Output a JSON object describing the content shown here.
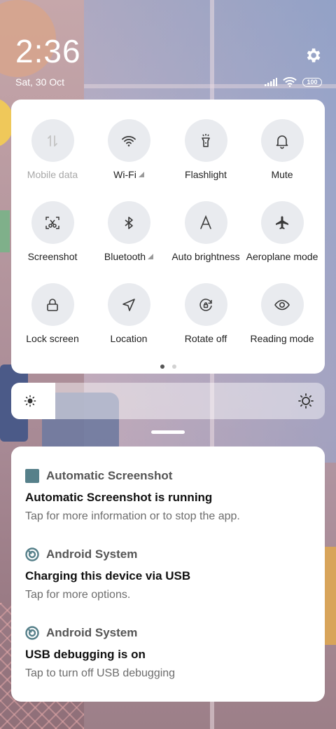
{
  "status": {
    "time": "2:36",
    "date": "Sat, 30 Oct",
    "battery": "100"
  },
  "quick_settings": {
    "tiles": [
      {
        "label": "Mobile data",
        "icon": "mobile-data-icon",
        "enabled": false
      },
      {
        "label": "Wi-Fi",
        "icon": "wifi-icon",
        "enabled": true
      },
      {
        "label": "Flashlight",
        "icon": "flashlight-icon",
        "enabled": true
      },
      {
        "label": "Mute",
        "icon": "bell-icon",
        "enabled": true
      },
      {
        "label": "Screenshot",
        "icon": "screenshot-scissors-icon",
        "enabled": true
      },
      {
        "label": "Bluetooth",
        "icon": "bluetooth-icon",
        "enabled": true
      },
      {
        "label": "Auto brightness",
        "icon": "auto-brightness-icon",
        "enabled": true
      },
      {
        "label": "Aeroplane mode",
        "icon": "airplane-icon",
        "enabled": true
      },
      {
        "label": "Lock screen",
        "icon": "lock-icon",
        "enabled": true
      },
      {
        "label": "Location",
        "icon": "location-arrow-icon",
        "enabled": true
      },
      {
        "label": "Rotate off",
        "icon": "rotate-lock-icon",
        "enabled": true
      },
      {
        "label": "Reading mode",
        "icon": "eye-icon",
        "enabled": true
      }
    ],
    "page_count": 2,
    "current_page": 1
  },
  "brightness": {
    "level": 0.14
  },
  "notifications": [
    {
      "app": "Automatic Screenshot",
      "icon": "app-square-icon",
      "title": "Automatic Screenshot is running",
      "body": "Tap for more information or to stop the app."
    },
    {
      "app": "Android System",
      "icon": "android-system-icon",
      "title": "Charging this device via USB",
      "body": "Tap for more options."
    },
    {
      "app": "Android System",
      "icon": "android-system-icon",
      "title": "USB debugging is on",
      "body": "Tap to turn off USB debugging"
    }
  ],
  "colors": {
    "tile_bg": "#e9ebef",
    "icon": "#4a4a4a",
    "app_icon": "#56808a"
  }
}
